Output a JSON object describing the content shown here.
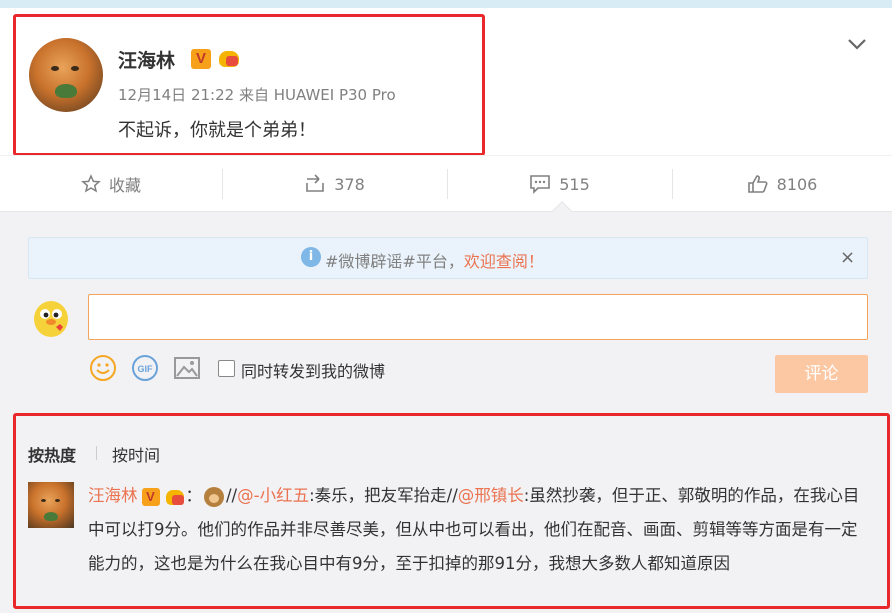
{
  "post": {
    "username": "汪海林",
    "v_badge": "V",
    "timestamp": "12月14日 21:22",
    "source_prefix": "来自",
    "source": "HUAWEI P30 Pro",
    "content": "不起诉，你就是个弟弟！"
  },
  "actions": {
    "favorite": "收藏",
    "repost_count": "378",
    "comment_count": "515",
    "like_count": "8106"
  },
  "notice": {
    "text": "#微博辟谣#平台，",
    "highlight": "欢迎查阅！",
    "close": "×"
  },
  "composer": {
    "input_value": "",
    "repost_label": "同时转发到我的微博",
    "submit": "评论",
    "gif_label": "GIF"
  },
  "sort": {
    "hot": "按热度",
    "time": "按时间"
  },
  "comment": {
    "username": "汪海林",
    "v_badge": "V",
    "sep1": "：",
    "part1": "//",
    "mention1": "@-小红五",
    "part2": ":奏乐，把友军抬走//",
    "mention2": "@邢镇长",
    "part3": ":虽然抄袭，但于正、郭敬明的作品，在我心目中可以打9分。他们的作品并非尽善尽美，但从中也可以看出，他们在配音、画面、剪辑等等方面是有一定能力的，这也是为什么在我心目中有9分，至于扣掉的那91分，我想大多数人都知道原因"
  },
  "colors": {
    "accent": "#eb7350",
    "highlight_box": "#e8282a",
    "submit_disabled": "#fbc8a3"
  }
}
